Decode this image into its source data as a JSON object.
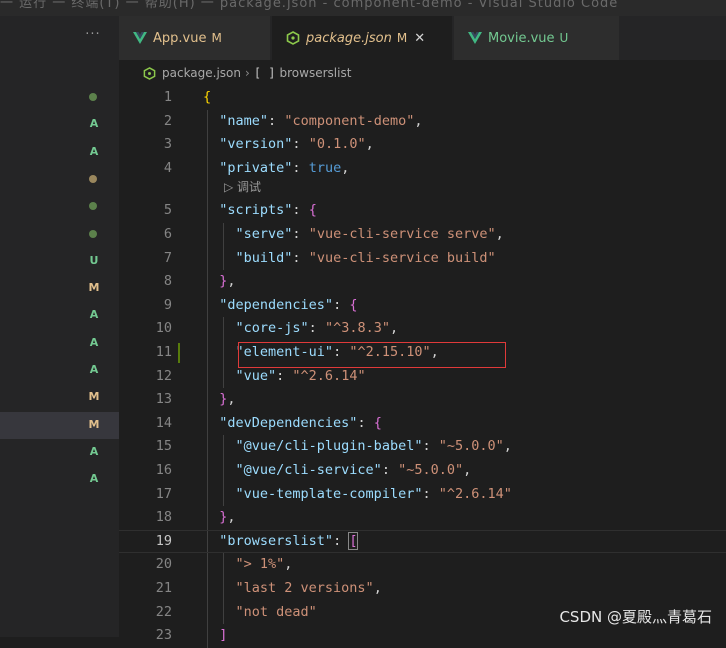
{
  "top_strip": {
    "text": "一 运行 一 终端(T) 一 帮助(H) 一 package.json - component-demo - Visual Studio Code"
  },
  "sidebar": {
    "more_label": "···",
    "items": [
      {
        "type": "dot",
        "color": "#6a9955"
      },
      {
        "type": "badge",
        "label": "A",
        "color": "#73c991"
      },
      {
        "type": "badge",
        "label": "A",
        "color": "#73c991"
      },
      {
        "type": "dot",
        "color": "#b8a06b"
      },
      {
        "type": "dot",
        "color": "#6a9955"
      },
      {
        "type": "dot",
        "color": "#6a9955"
      },
      {
        "type": "badge",
        "label": "U",
        "color": "#73c991"
      },
      {
        "type": "badge",
        "label": "M",
        "color": "#e2c08d"
      },
      {
        "type": "badge",
        "label": "A",
        "color": "#73c991"
      },
      {
        "type": "badge",
        "label": "A",
        "color": "#73c991"
      },
      {
        "type": "badge",
        "label": "A",
        "color": "#73c991"
      },
      {
        "type": "badge",
        "label": "M",
        "color": "#e2c08d"
      },
      {
        "type": "badge",
        "label": "M",
        "color": "#e2c08d",
        "selected": true
      },
      {
        "type": "badge",
        "label": "A",
        "color": "#73c991"
      },
      {
        "type": "badge",
        "label": "A",
        "color": "#73c991"
      }
    ]
  },
  "tabs": [
    {
      "label": "App.vue",
      "status": "M",
      "icon": "vue-icon",
      "color": "#e2c08d",
      "active": false
    },
    {
      "label": "package.json",
      "status": "M",
      "icon": "nodejs-icon",
      "color": "#e2c08d",
      "active": true,
      "close": "✕"
    },
    {
      "label": "Movie.vue",
      "status": "U",
      "icon": "vue-icon",
      "color": "#73c991",
      "active": false
    }
  ],
  "breadcrumb": {
    "file": "package.json",
    "separator": "›",
    "brackets": "[ ]",
    "node": "browserslist"
  },
  "editor": {
    "codelens": "▷ 调试",
    "lines": [
      {
        "n": "1",
        "tokens": [
          [
            "{",
            "brace0"
          ]
        ]
      },
      {
        "n": "2",
        "tokens": [
          [
            "  ",
            "p"
          ],
          [
            "\"name\"",
            "k"
          ],
          [
            ": ",
            "p"
          ],
          [
            "\"component-demo\"",
            "s"
          ],
          [
            ",",
            "p"
          ]
        ]
      },
      {
        "n": "3",
        "tokens": [
          [
            "  ",
            "p"
          ],
          [
            "\"version\"",
            "k"
          ],
          [
            ": ",
            "p"
          ],
          [
            "\"0.1.0\"",
            "s"
          ],
          [
            ",",
            "p"
          ]
        ]
      },
      {
        "n": "4",
        "tokens": [
          [
            "  ",
            "p"
          ],
          [
            "\"private\"",
            "k"
          ],
          [
            ": ",
            "p"
          ],
          [
            "true",
            "b"
          ],
          [
            ",",
            "p"
          ]
        ]
      },
      {
        "n": "5",
        "tokens": [
          [
            "  ",
            "p"
          ],
          [
            "\"scripts\"",
            "k"
          ],
          [
            ": ",
            "p"
          ],
          [
            "{",
            "brace1"
          ]
        ]
      },
      {
        "n": "6",
        "tokens": [
          [
            "    ",
            "p"
          ],
          [
            "\"serve\"",
            "k"
          ],
          [
            ": ",
            "p"
          ],
          [
            "\"vue-cli-service serve\"",
            "s"
          ],
          [
            ",",
            "p"
          ]
        ]
      },
      {
        "n": "7",
        "tokens": [
          [
            "    ",
            "p"
          ],
          [
            "\"build\"",
            "k"
          ],
          [
            ": ",
            "p"
          ],
          [
            "\"vue-cli-service build\"",
            "s"
          ]
        ]
      },
      {
        "n": "8",
        "tokens": [
          [
            "  ",
            "p"
          ],
          [
            "}",
            "brace1"
          ],
          [
            ",",
            "p"
          ]
        ]
      },
      {
        "n": "9",
        "tokens": [
          [
            "  ",
            "p"
          ],
          [
            "\"dependencies\"",
            "k"
          ],
          [
            ": ",
            "p"
          ],
          [
            "{",
            "brace1"
          ]
        ]
      },
      {
        "n": "10",
        "tokens": [
          [
            "    ",
            "p"
          ],
          [
            "\"core-js\"",
            "k"
          ],
          [
            ": ",
            "p"
          ],
          [
            "\"^3.8.3\"",
            "s"
          ],
          [
            ",",
            "p"
          ]
        ]
      },
      {
        "n": "11",
        "tokens": [
          [
            "    ",
            "p"
          ],
          [
            "\"element-ui\"",
            "k"
          ],
          [
            ": ",
            "p"
          ],
          [
            "\"^2.15.10\"",
            "s"
          ],
          [
            ",",
            "p"
          ]
        ]
      },
      {
        "n": "12",
        "tokens": [
          [
            "    ",
            "p"
          ],
          [
            "\"vue\"",
            "k"
          ],
          [
            ": ",
            "p"
          ],
          [
            "\"^2.6.14\"",
            "s"
          ]
        ]
      },
      {
        "n": "13",
        "tokens": [
          [
            "  ",
            "p"
          ],
          [
            "}",
            "brace1"
          ],
          [
            ",",
            "p"
          ]
        ]
      },
      {
        "n": "14",
        "tokens": [
          [
            "  ",
            "p"
          ],
          [
            "\"devDependencies\"",
            "k"
          ],
          [
            ": ",
            "p"
          ],
          [
            "{",
            "brace1"
          ]
        ]
      },
      {
        "n": "15",
        "tokens": [
          [
            "    ",
            "p"
          ],
          [
            "\"@vue/cli-plugin-babel\"",
            "k"
          ],
          [
            ": ",
            "p"
          ],
          [
            "\"~5.0.0\"",
            "s"
          ],
          [
            ",",
            "p"
          ]
        ]
      },
      {
        "n": "16",
        "tokens": [
          [
            "    ",
            "p"
          ],
          [
            "\"@vue/cli-service\"",
            "k"
          ],
          [
            ": ",
            "p"
          ],
          [
            "\"~5.0.0\"",
            "s"
          ],
          [
            ",",
            "p"
          ]
        ]
      },
      {
        "n": "17",
        "tokens": [
          [
            "    ",
            "p"
          ],
          [
            "\"vue-template-compiler\"",
            "k"
          ],
          [
            ": ",
            "p"
          ],
          [
            "\"^2.6.14\"",
            "s"
          ]
        ]
      },
      {
        "n": "18",
        "tokens": [
          [
            "  ",
            "p"
          ],
          [
            "}",
            "brace1"
          ],
          [
            ",",
            "p"
          ]
        ]
      },
      {
        "n": "19",
        "tokens": [
          [
            "  ",
            "p"
          ],
          [
            "\"browserslist\"",
            "k"
          ],
          [
            ": ",
            "p"
          ],
          [
            "[",
            "brace1"
          ]
        ]
      },
      {
        "n": "20",
        "tokens": [
          [
            "    ",
            "p"
          ],
          [
            "\"> 1%\"",
            "s"
          ],
          [
            ",",
            "p"
          ]
        ]
      },
      {
        "n": "21",
        "tokens": [
          [
            "    ",
            "p"
          ],
          [
            "\"last 2 versions\"",
            "s"
          ],
          [
            ",",
            "p"
          ]
        ]
      },
      {
        "n": "22",
        "tokens": [
          [
            "    ",
            "p"
          ],
          [
            "\"not dead\"",
            "s"
          ]
        ]
      },
      {
        "n": "23",
        "tokens": [
          [
            "  ",
            "p"
          ],
          [
            "]",
            "brace1"
          ]
        ]
      }
    ]
  },
  "watermark": "CSDN @夏殿灬青葛石"
}
